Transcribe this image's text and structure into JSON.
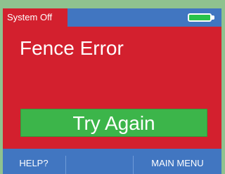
{
  "status_bar": {
    "system_state": "System Off",
    "battery_icon": "battery-full-icon",
    "battery_color": "#29c24a"
  },
  "main": {
    "error_title": "Fence Error",
    "try_again_label": "Try Again"
  },
  "bottom_bar": {
    "help_label": "HELP?",
    "middle_label": "",
    "main_menu_label": "MAIN MENU"
  },
  "colors": {
    "error_background": "#d3202e",
    "bar_background": "#4176c1",
    "button_background": "#3cb54a",
    "frame": "#8fc28f"
  }
}
